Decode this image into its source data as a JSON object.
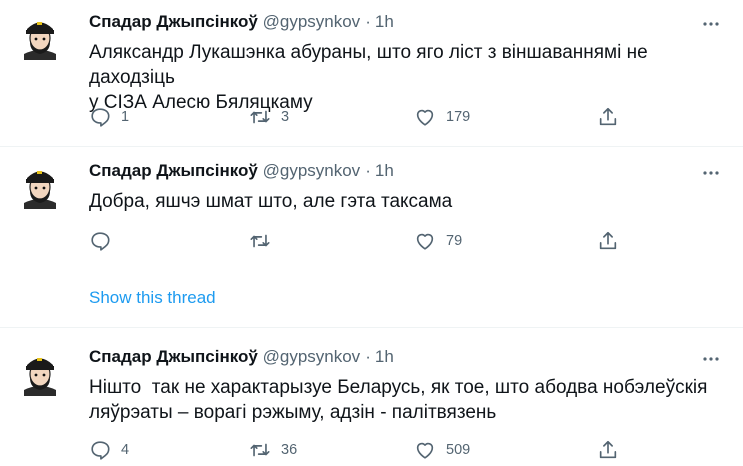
{
  "tweets": [
    {
      "author": "Спадар Джыпсінкоў",
      "handle": "@gypsynkov",
      "separator": "·",
      "time": "1h",
      "text_lines": [
        "Аляксандр Лукашэнка абураны, што яго ліст з віншаваннямі не даходзіць",
        "у СІЗА Алесю Бяляцкаму"
      ],
      "replies": "1",
      "retweets": "3",
      "likes": "179"
    },
    {
      "author": "Спадар Джыпсінкоў",
      "handle": "@gypsynkov",
      "separator": "·",
      "time": "1h",
      "text_lines": [
        "Добра, яшчэ шмат што, але гэта таксама"
      ],
      "replies": "",
      "retweets": "",
      "likes": "79",
      "show_thread": "Show this thread"
    },
    {
      "author": "Спадар Джыпсінкоў",
      "handle": "@gypsynkov",
      "separator": "·",
      "time": "1h",
      "text_lines": [
        "Нішто  так не характарызуе Беларусь, як тое, што абодва нобэлеўскія",
        "ляўрэаты – ворагі рэжыму, адзін - палітвязень"
      ],
      "replies": "4",
      "retweets": "36",
      "likes": "509"
    }
  ],
  "colors": {
    "text": "#0f1419",
    "secondary": "#536471",
    "link": "#1d9bf0",
    "divider": "#eff3f4"
  },
  "icons": {
    "reply": "reply-icon",
    "retweet": "retweet-icon",
    "like": "like-icon",
    "share": "share-icon",
    "more": "more-icon"
  }
}
